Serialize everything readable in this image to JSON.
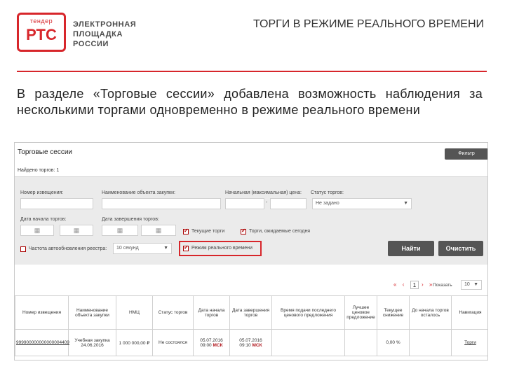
{
  "header": {
    "logo_small": "тендер",
    "logo_big": "РТС",
    "logo_lines": [
      "ЭЛЕКТРОННАЯ",
      "ПЛОЩАДКА",
      "РОССИИ"
    ],
    "title": "ТОРГИ В РЕЖИМЕ РЕАЛЬНОГО ВРЕМЕНИ"
  },
  "description": "В разделе «Торговые сессии» добавлена возможность наблюдения за несколькими торгами одновременно в режиме реального времени",
  "screen": {
    "title": "Торговые сессии",
    "filter_button": "Фильтр",
    "found": "Найдено торгов: 1",
    "filters": {
      "notice_number_label": "Номер извещения:",
      "object_name_label": "Наименование объекта закупки:",
      "price_label": "Начальная (максимальная) цена:",
      "price_dash": "-",
      "status_label": "Статус торгов:",
      "status_value": "Не задано",
      "start_date_label": "Дата начала торгов:",
      "end_date_label": "Дата завершения торгов:",
      "current_trades_label": "Текущие торги",
      "current_trades_checked": true,
      "today_trades_label": "Торги, ожидаемые сегодня",
      "today_trades_checked": true,
      "refresh_label": "Частота автообновления реестра:",
      "refresh_checked": false,
      "refresh_value": "10 секунд",
      "realtime_label": "Режим реального времени",
      "realtime_checked": true,
      "find_button": "Найти",
      "clear_button": "Очистить"
    },
    "pager": {
      "first": "«",
      "prev": "‹",
      "page": "1",
      "next": "›",
      "last": "»",
      "show_label": "Показать",
      "per_page": "10"
    },
    "table": {
      "columns": [
        "Номер извещения",
        "Наименование объекта закупки",
        "НМЦ",
        "Статус торгов",
        "Дата начала торгов",
        "Дата завершения торгов",
        "Время подачи последнего ценового предложения",
        "Лучшее ценовое предложение",
        "Текущее снижение",
        "До начала торгов осталось",
        "Навигация"
      ],
      "rows": [
        {
          "notice": "999900000000000004409",
          "object": "Учебная закупка 24.06.2016",
          "nmc": "1 000 000,00 ₽",
          "status": "Не состоялся",
          "start_date": "05.07.2016",
          "start_time": "09:00",
          "end_date": "05.07.2016",
          "end_time": "09:10",
          "tz": "МСК",
          "last_bid_time": "",
          "best_offer": "",
          "reduction": "0,00 %",
          "time_left": "",
          "nav": "Торги"
        }
      ]
    }
  },
  "colors": {
    "brand": "#d7262b",
    "button_dark": "#555555",
    "filter_bg": "#ebebeb"
  }
}
